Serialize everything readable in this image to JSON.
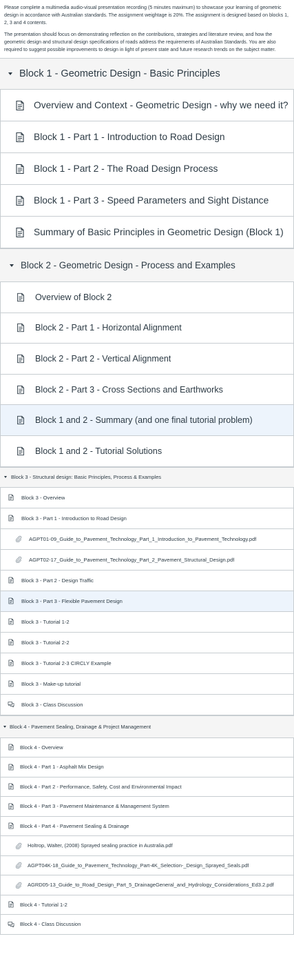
{
  "intro": {
    "paragraph1": "Please complete a multimedia audio-visual presentation recording (5 minutes maximum) to showcase your learning of geometric design in accordance with Australian standards. The assignment weightage is 20%. The assignment is designed based on blocks 1, 2, 3 and 4 contents.",
    "paragraph2": "The presentation should focus on demonstrating reflection on the contributions, strategies and literature review, and how the geometric design and structural design specifications of roads address the requirements of Australian Standards. You are also required to suggest possible improvements to design in light of present state and future research trends on the subject matter."
  },
  "modules": [
    {
      "title": "Block 1 - Geometric Design - Basic Principles",
      "items": [
        {
          "label": "Overview and Context - Geometric Design - why we need it?",
          "icon": "page-icon"
        },
        {
          "label": "Block 1 - Part 1 - Introduction to Road Design",
          "icon": "page-icon"
        },
        {
          "label": "Block 1 - Part 2 - The Road Design Process",
          "icon": "page-icon"
        },
        {
          "label": "Block 1 - Part 3 - Speed Parameters and Sight Distance",
          "icon": "page-icon"
        },
        {
          "label": "Summary of Basic Principles in Geometric Design (Block 1)",
          "icon": "page-icon"
        }
      ]
    },
    {
      "title": "Block 2 - Geometric Design - Process and Examples",
      "items": [
        {
          "label": "Overview of Block 2",
          "icon": "page-icon"
        },
        {
          "label": "Block 2 - Part 1 - Horizontal Alignment",
          "icon": "page-icon"
        },
        {
          "label": "Block 2 - Part 2 - Vertical Alignment",
          "icon": "page-icon"
        },
        {
          "label": "Block 2 - Part 3 - Cross Sections and Earthworks",
          "icon": "page-icon"
        },
        {
          "label": "Block 1 and 2 - Summary (and one final tutorial problem)",
          "icon": "page-icon",
          "highlighted": true
        },
        {
          "label": "Block 1 and 2 - Tutorial Solutions",
          "icon": "page-icon"
        }
      ]
    },
    {
      "title": "Block 3 - Structural design: Basic Principles, Process & Examples",
      "items": [
        {
          "label": "Block 3 - Overview",
          "icon": "page-icon"
        },
        {
          "label": "Block 3 - Part 1 - Introduction to Road Design",
          "icon": "page-icon"
        },
        {
          "label": "AGPT01-09_Guide_to_Pavement_Technology_Part_1_Introduction_to_Pavement_Technology.pdf",
          "icon": "attachment-icon"
        },
        {
          "label": "AGPT02-17_Guide_to_Pavement_Technology_Part_2_Pavement_Structural_Design.pdf",
          "icon": "attachment-icon"
        },
        {
          "label": "Block 3 - Part 2 - Design Traffic",
          "icon": "page-icon"
        },
        {
          "label": "Block 3 - Part 3 - Flexible Pavement Design",
          "icon": "page-icon",
          "highlighted": true
        },
        {
          "label": "Block 3 - Tutorial 1-2",
          "icon": "page-icon"
        },
        {
          "label": "Block 3 - Tutorial 2-2",
          "icon": "page-icon"
        },
        {
          "label": "Block 3 - Tutorial 2-3 CIRCLY Example",
          "icon": "page-icon"
        },
        {
          "label": "Block 3 - Make-up tutorial",
          "icon": "page-icon"
        },
        {
          "label": "Block 3 - Class Discussion",
          "icon": "discussion-icon"
        }
      ]
    },
    {
      "title": "Block 4 - Pavement Sealing, Drainage & Project Management",
      "items": [
        {
          "label": "Block 4 - Overview",
          "icon": "page-icon"
        },
        {
          "label": "Block 4 - Part 1 - Asphalt Mix Design",
          "icon": "page-icon"
        },
        {
          "label": "Block 4 - Part 2 - Performance, Safety, Cost and Environmental Impact",
          "icon": "page-icon"
        },
        {
          "label": "Block 4 - Part 3 - Pavement Maintenance & Management System",
          "icon": "page-icon"
        },
        {
          "label": "Block 4 - Part 4 - Pavement Sealing & Drainage",
          "icon": "page-icon"
        },
        {
          "label": "Holtrop, Walter, (2008) Sprayed sealing practice in Australia.pdf",
          "icon": "attachment-icon"
        },
        {
          "label": "AGPT04K-18_Guide_to_Pavement_Technology_Part-4K_Selection-_Design_Sprayed_Seals.pdf",
          "icon": "attachment-icon"
        },
        {
          "label": "AGRD05-13_Guide_to_Road_Design_Part_5_DrainageGeneral_and_Hydrology_Considerations_Ed3.2.pdf",
          "icon": "attachment-icon"
        },
        {
          "label": "Block 4 - Tutorial 1-2",
          "icon": "page-icon"
        },
        {
          "label": "Block 4 - Class Discussion",
          "icon": "discussion-icon"
        }
      ]
    }
  ]
}
